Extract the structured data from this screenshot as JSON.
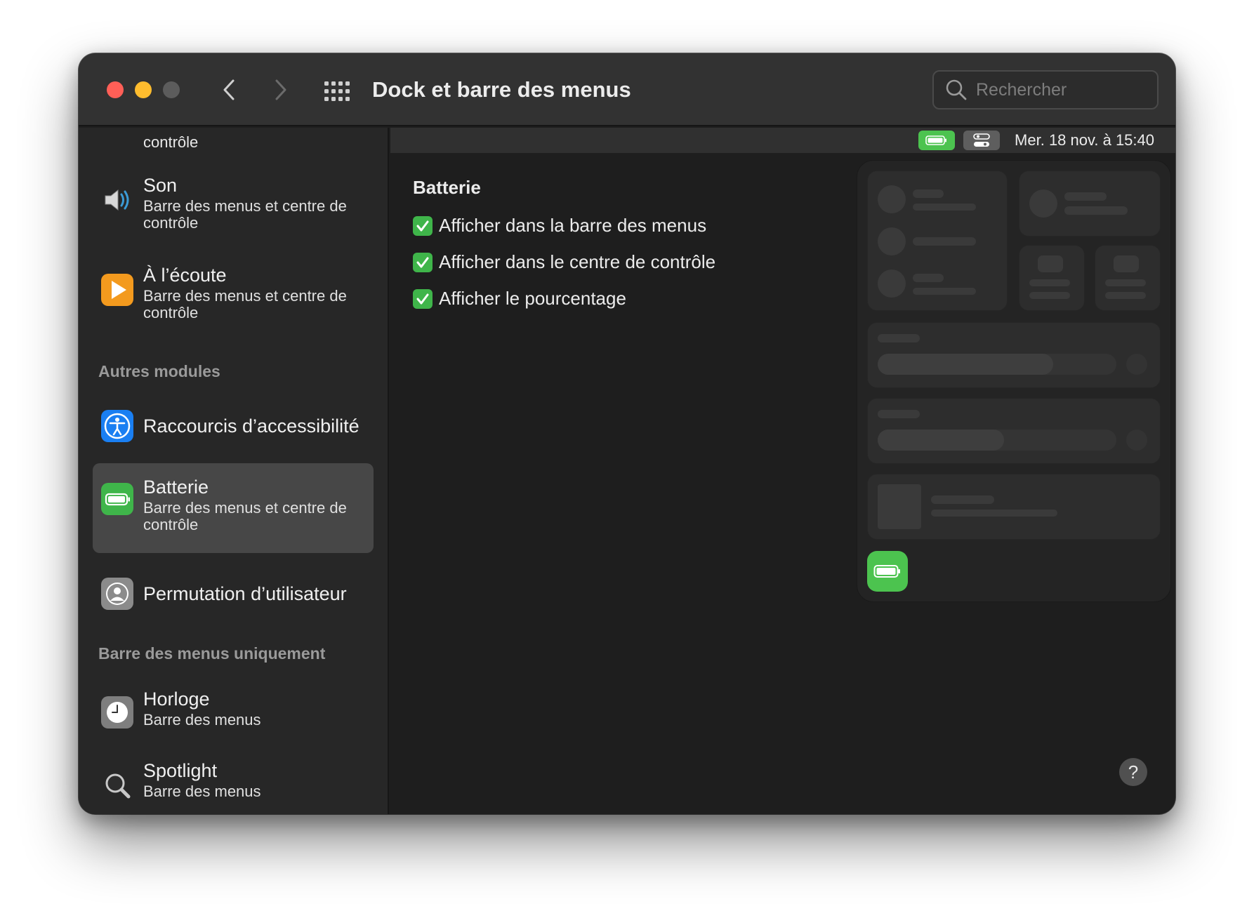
{
  "window": {
    "title": "Dock et barre des menus",
    "search_placeholder": "Rechercher"
  },
  "menubar": {
    "clock": "Mer. 18 nov. à  15:40",
    "battery_icon": "battery-icon",
    "control_center_icon": "control-center-icon"
  },
  "sidebar": {
    "cut_text": "contrôle",
    "items": [
      {
        "name": "Son",
        "sub": "Barre des menus et centre de contrôle",
        "icon": "speaker-icon"
      },
      {
        "name": "À l’écoute",
        "sub": "Barre des menus et centre de contrôle",
        "icon": "now-playing-icon"
      },
      {
        "name": "Raccourcis d’accessibilité",
        "sub": "",
        "icon": "accessibility-icon"
      },
      {
        "name": "Batterie",
        "sub": "Barre des menus et centre de contrôle",
        "icon": "battery-icon",
        "selected": true
      },
      {
        "name": "Permutation d’utilisateur",
        "sub": "",
        "icon": "user-icon"
      },
      {
        "name": "Horloge",
        "sub": "Barre des menus",
        "icon": "clock-icon"
      },
      {
        "name": "Spotlight",
        "sub": "Barre des menus",
        "icon": "spotlight-icon"
      }
    ],
    "sections": {
      "other_modules": "Autres modules",
      "menubar_only": "Barre des menus uniquement"
    }
  },
  "content": {
    "section_title": "Batterie",
    "options": [
      {
        "label": "Afficher dans la barre des menus",
        "checked": true
      },
      {
        "label": "Afficher dans le centre de contrôle",
        "checked": true
      },
      {
        "label": "Afficher le pourcentage",
        "checked": true
      }
    ],
    "help_label": "?"
  },
  "colors": {
    "accent_green": "#4cc34f",
    "checkbox_green": "#3fb54a",
    "selected_row": "#474747",
    "traffic_close": "#ff5f57",
    "traffic_min": "#febc2e"
  }
}
